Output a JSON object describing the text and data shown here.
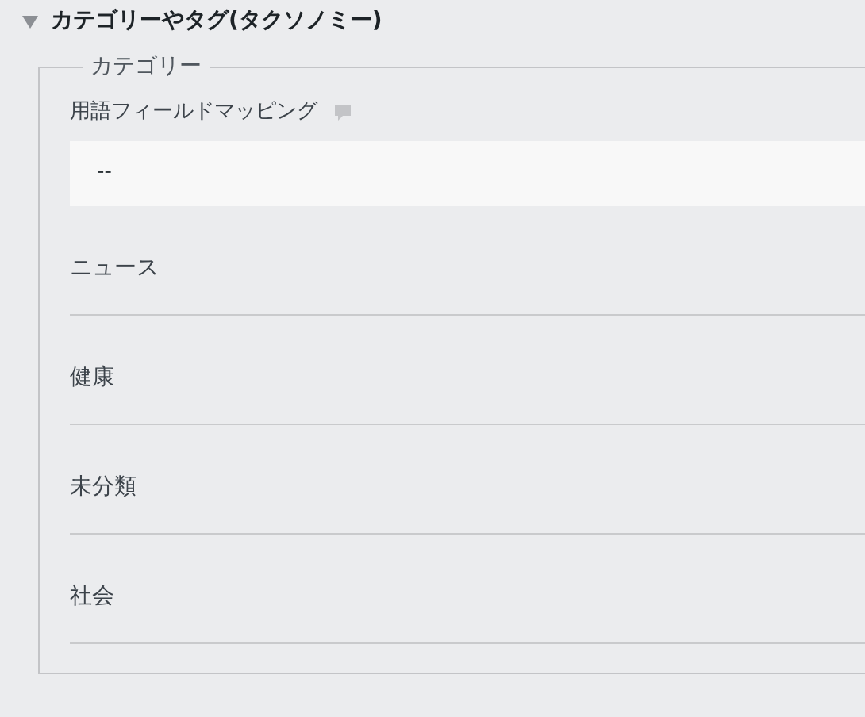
{
  "section": {
    "title": "カテゴリーやタグ(タクソノミー)",
    "expanded": true
  },
  "fieldset": {
    "legend": "カテゴリー",
    "field_label": "用語フィールドマッピング",
    "select_value": "--",
    "terms": [
      {
        "label": "ニュース"
      },
      {
        "label": "健康"
      },
      {
        "label": "未分類"
      },
      {
        "label": "社会"
      }
    ]
  }
}
